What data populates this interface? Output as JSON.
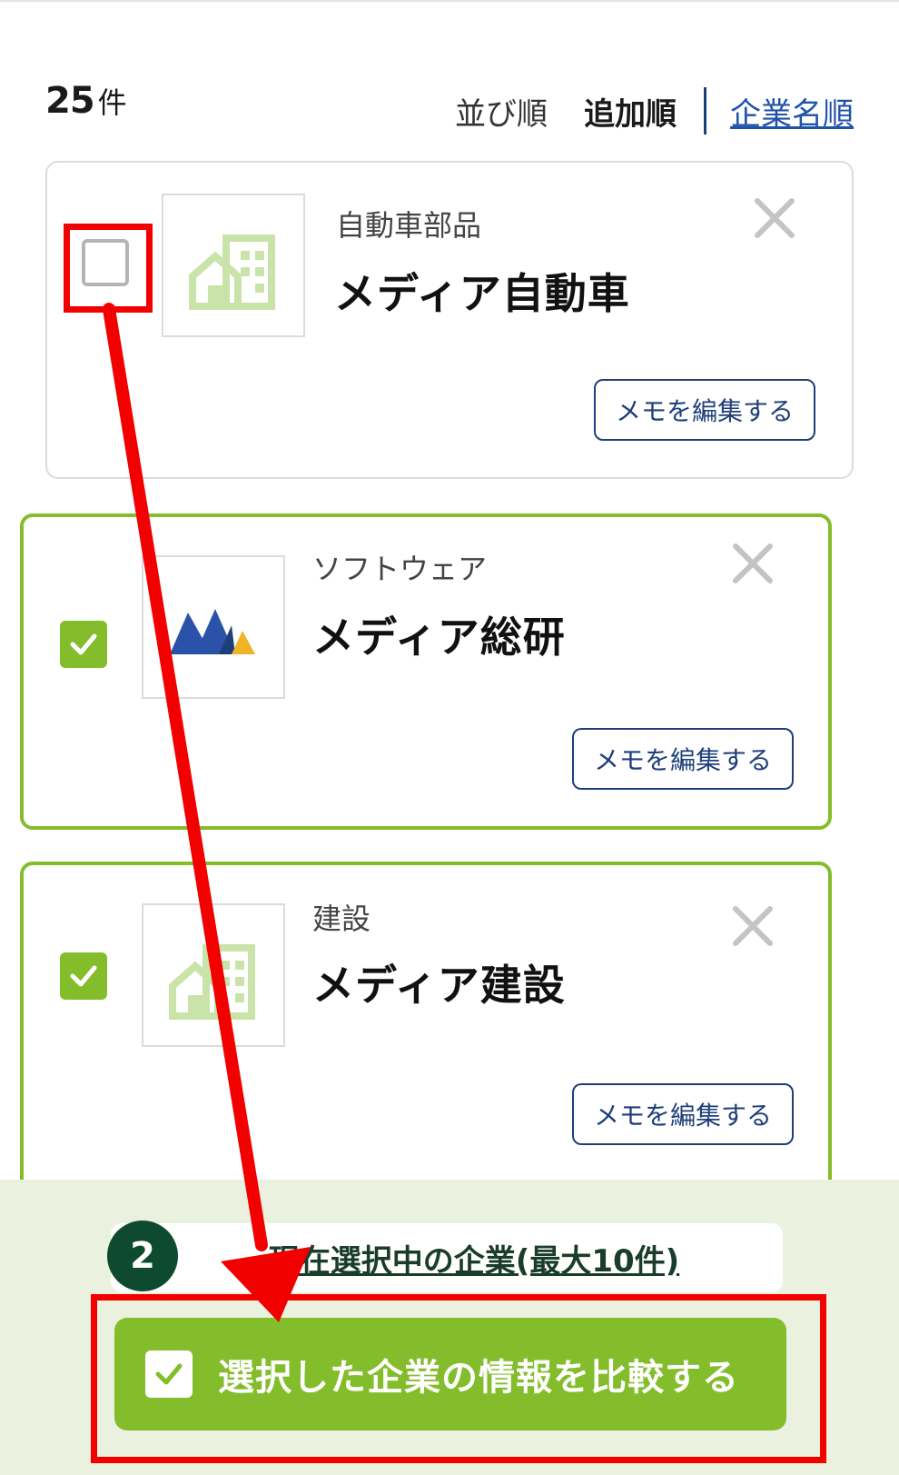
{
  "header": {
    "count_number": "25",
    "count_unit": "件",
    "sort_label": "並び順",
    "sort_options": [
      {
        "label": "追加順",
        "active": true
      },
      {
        "label": "企業名順",
        "active": false
      }
    ]
  },
  "cards": [
    {
      "category": "自動車部品",
      "name": "メディア自動車",
      "checked": false,
      "logo": "building-placeholder-icon",
      "memo_label": "メモを編集する"
    },
    {
      "category": "ソフトウェア",
      "name": "メディア総研",
      "checked": true,
      "logo": "mountain-logo-icon",
      "memo_label": "メモを編集する"
    },
    {
      "category": "建設",
      "name": "メディア建設",
      "checked": true,
      "logo": "building-placeholder-icon",
      "memo_label": "メモを編集する"
    }
  ],
  "bottom": {
    "step_number": "2",
    "selected_link": "現在選択中の企業(最大10件)",
    "compare_button": "選択した企業の情報を比較する"
  },
  "colors": {
    "accent_green": "#84bd2c",
    "navy": "#1f3f7a",
    "highlight_red": "#f20000",
    "panel_bg": "#eaf2df",
    "badge_green": "#0e4a2e"
  }
}
